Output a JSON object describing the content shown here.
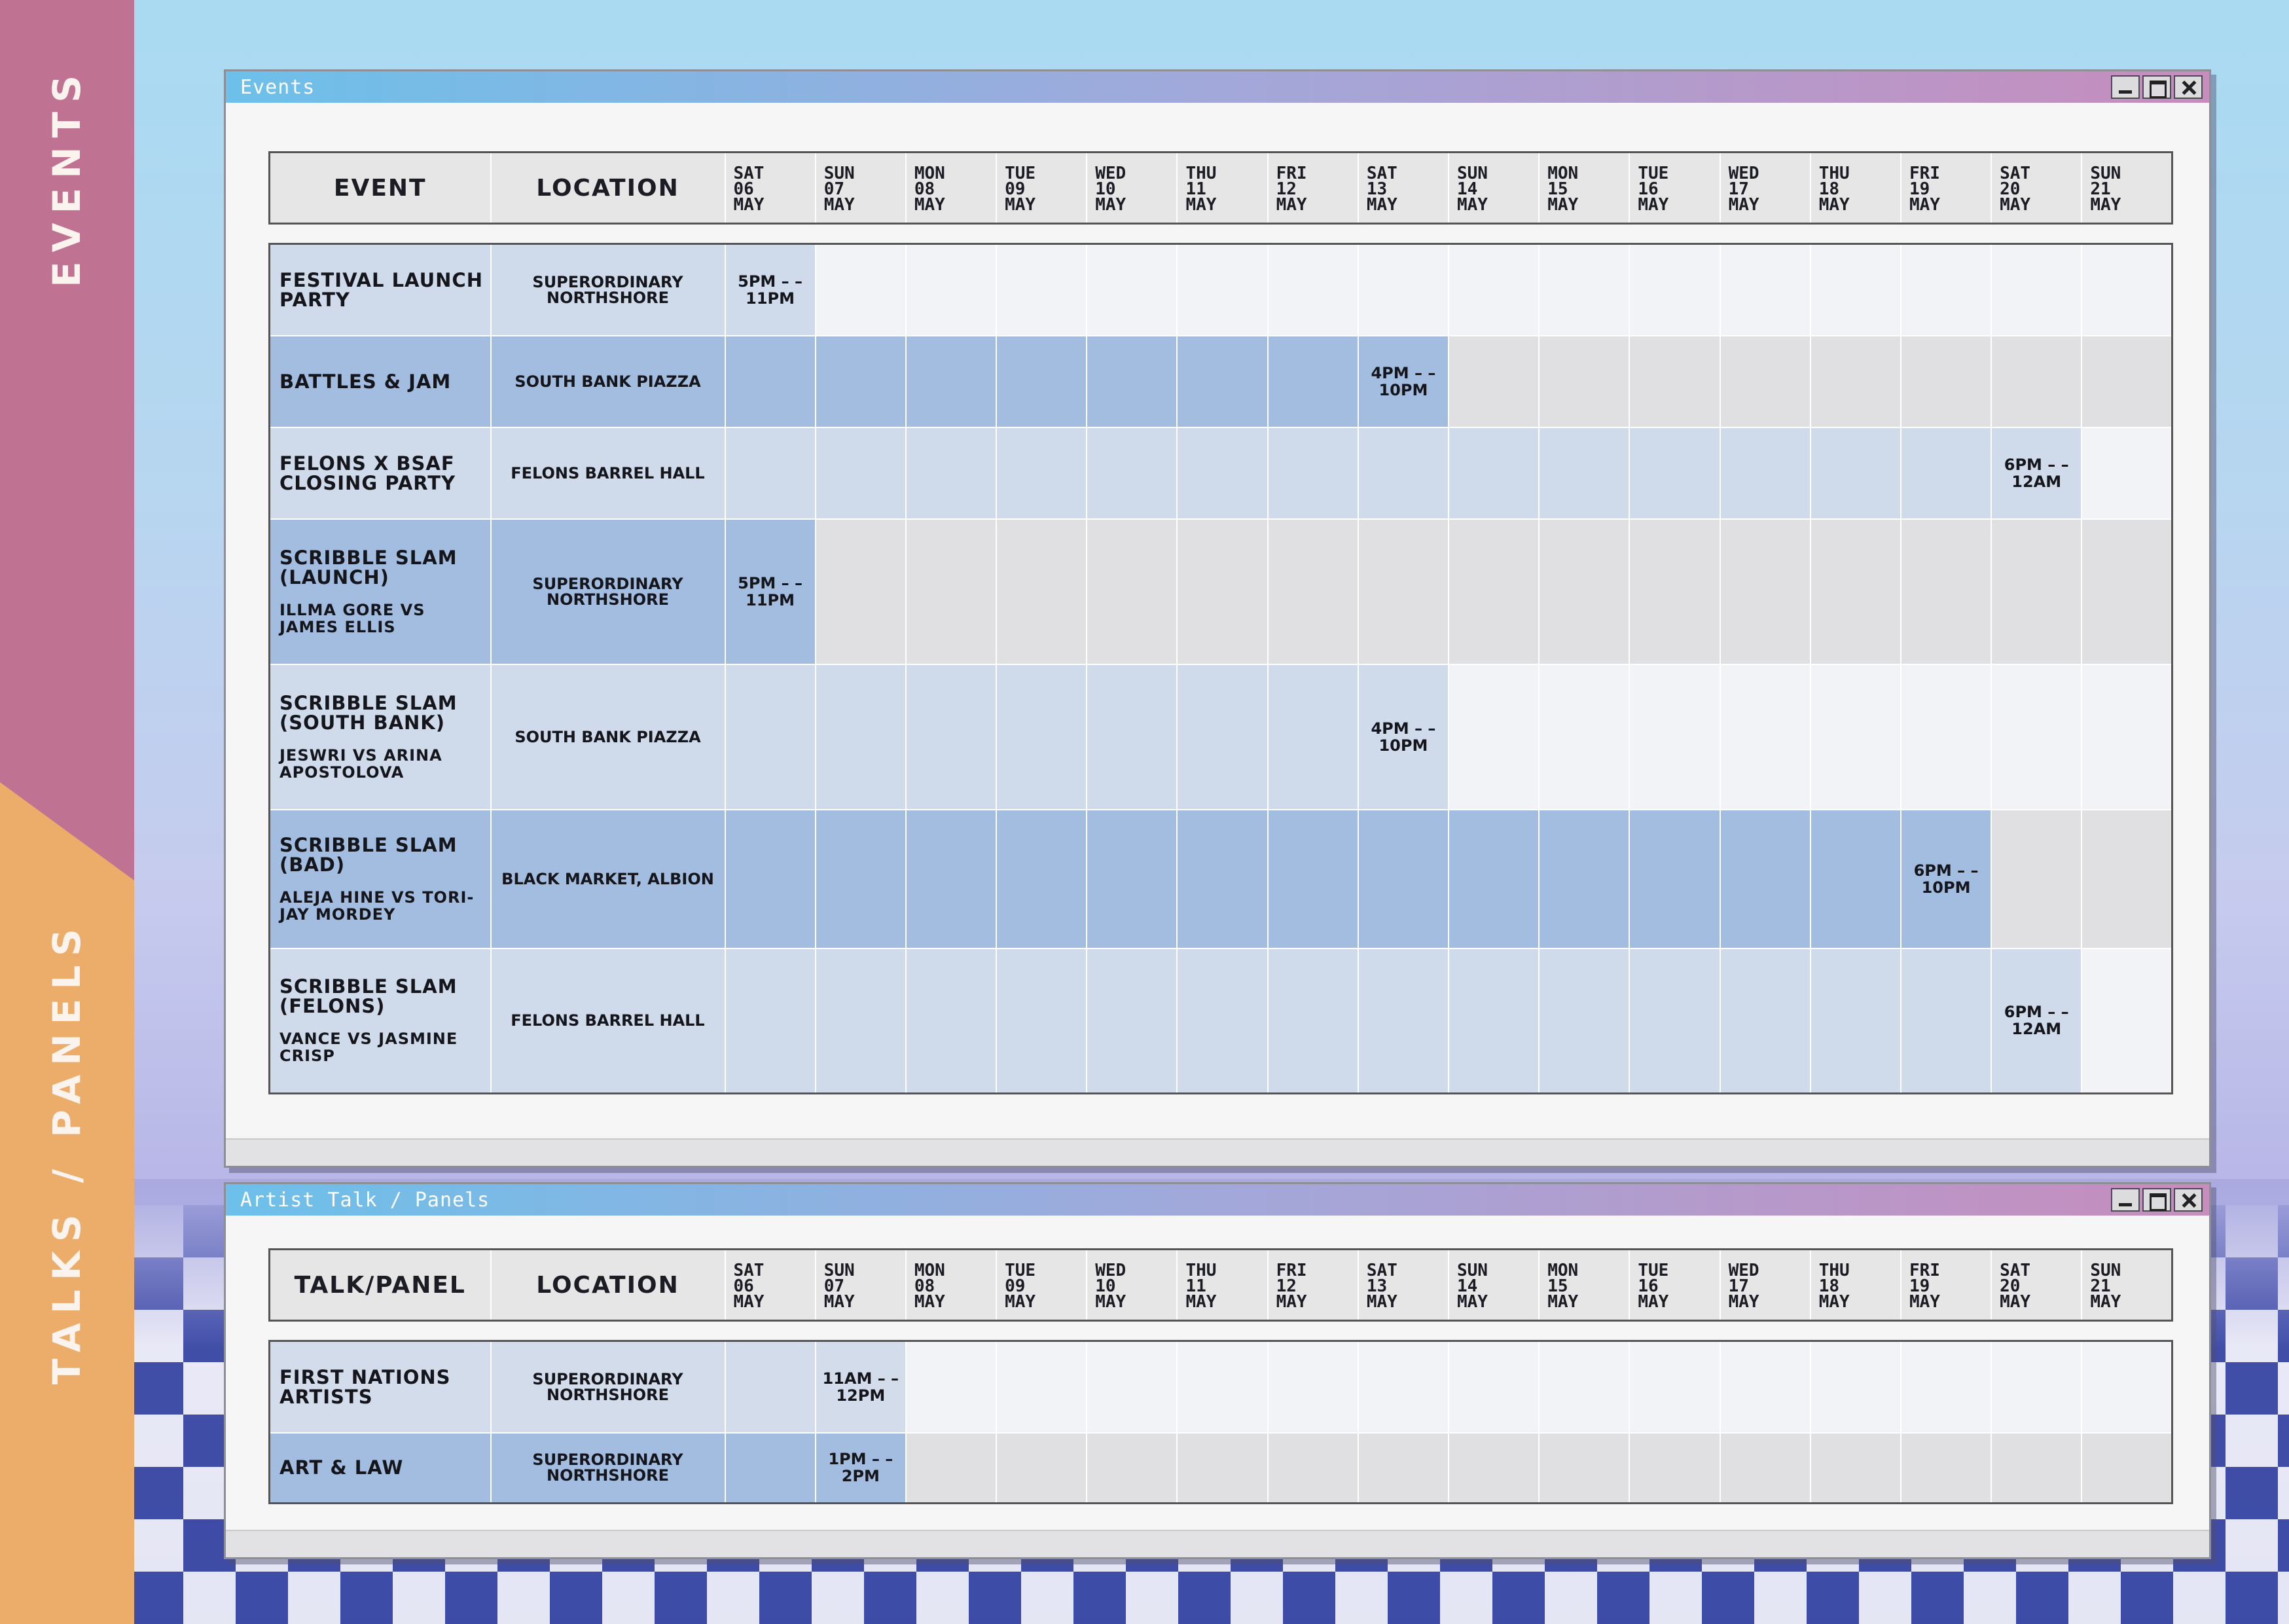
{
  "sidebar": {
    "events_label": "EVENTS",
    "talks_label": "TALKS / PANELS"
  },
  "events_window": {
    "title": "Events",
    "header": {
      "event": "EVENT",
      "location": "LOCATION"
    },
    "days": [
      {
        "dow": "SAT",
        "num": "06",
        "mon": "MAY"
      },
      {
        "dow": "SUN",
        "num": "07",
        "mon": "MAY"
      },
      {
        "dow": "MON",
        "num": "08",
        "mon": "MAY"
      },
      {
        "dow": "TUE",
        "num": "09",
        "mon": "MAY"
      },
      {
        "dow": "WED",
        "num": "10",
        "mon": "MAY"
      },
      {
        "dow": "THU",
        "num": "11",
        "mon": "MAY"
      },
      {
        "dow": "FRI",
        "num": "12",
        "mon": "MAY"
      },
      {
        "dow": "SAT",
        "num": "13",
        "mon": "MAY"
      },
      {
        "dow": "SUN",
        "num": "14",
        "mon": "MAY"
      },
      {
        "dow": "MON",
        "num": "15",
        "mon": "MAY"
      },
      {
        "dow": "TUE",
        "num": "16",
        "mon": "MAY"
      },
      {
        "dow": "WED",
        "num": "17",
        "mon": "MAY"
      },
      {
        "dow": "THU",
        "num": "18",
        "mon": "MAY"
      },
      {
        "dow": "FRI",
        "num": "19",
        "mon": "MAY"
      },
      {
        "dow": "SAT",
        "num": "20",
        "mon": "MAY"
      },
      {
        "dow": "SUN",
        "num": "21",
        "mon": "MAY"
      }
    ],
    "rows": [
      {
        "event": "FESTIVAL LAUNCH PARTY",
        "sub": "",
        "location": "SUPERORDINARY NORTHSHORE",
        "day_index": 0,
        "time": "5PM – – 11PM"
      },
      {
        "event": "BATTLES & JAM",
        "sub": "",
        "location": "SOUTH BANK PIAZZA",
        "day_index": 7,
        "time": "4PM – – 10PM"
      },
      {
        "event": "FELONS X BSAF CLOSING PARTY",
        "sub": "",
        "location": "FELONS BARREL HALL",
        "day_index": 14,
        "time": "6PM – – 12AM"
      },
      {
        "event": "SCRIBBLE SLAM (LAUNCH)",
        "sub": "ILLMA GORE VS JAMES ELLIS",
        "location": "SUPERORDINARY NORTHSHORE",
        "day_index": 0,
        "time": "5PM – – 11PM"
      },
      {
        "event": "SCRIBBLE SLAM (SOUTH BANK)",
        "sub": "JESWRI VS ARINA APOSTOLOVA",
        "location": "SOUTH BANK PIAZZA",
        "day_index": 7,
        "time": "4PM – – 10PM"
      },
      {
        "event": "SCRIBBLE SLAM (BAD)",
        "sub": "ALEJA HINE VS TORI-JAY MORDEY",
        "location": "BLACK MARKET, ALBION",
        "day_index": 13,
        "time": "6PM – – 10PM"
      },
      {
        "event": "SCRIBBLE SLAM (FELONS)",
        "sub": "VANCE VS JASMINE CRISP",
        "location": "FELONS BARREL HALL",
        "day_index": 14,
        "time": "6PM – – 12AM"
      }
    ]
  },
  "talks_window": {
    "title": "Artist Talk / Panels",
    "header": {
      "event": "TALK/PANEL",
      "location": "LOCATION"
    },
    "rows": [
      {
        "event": "FIRST NATIONS ARTISTS",
        "sub": "",
        "location": "SUPERORDINARY NORTHSHORE",
        "day_index": 1,
        "time": "11AM – – 12PM"
      },
      {
        "event": "ART & LAW",
        "sub": "",
        "location": "SUPERORDINARY NORTHSHORE",
        "day_index": 1,
        "time": "1PM – – 2PM"
      }
    ]
  }
}
